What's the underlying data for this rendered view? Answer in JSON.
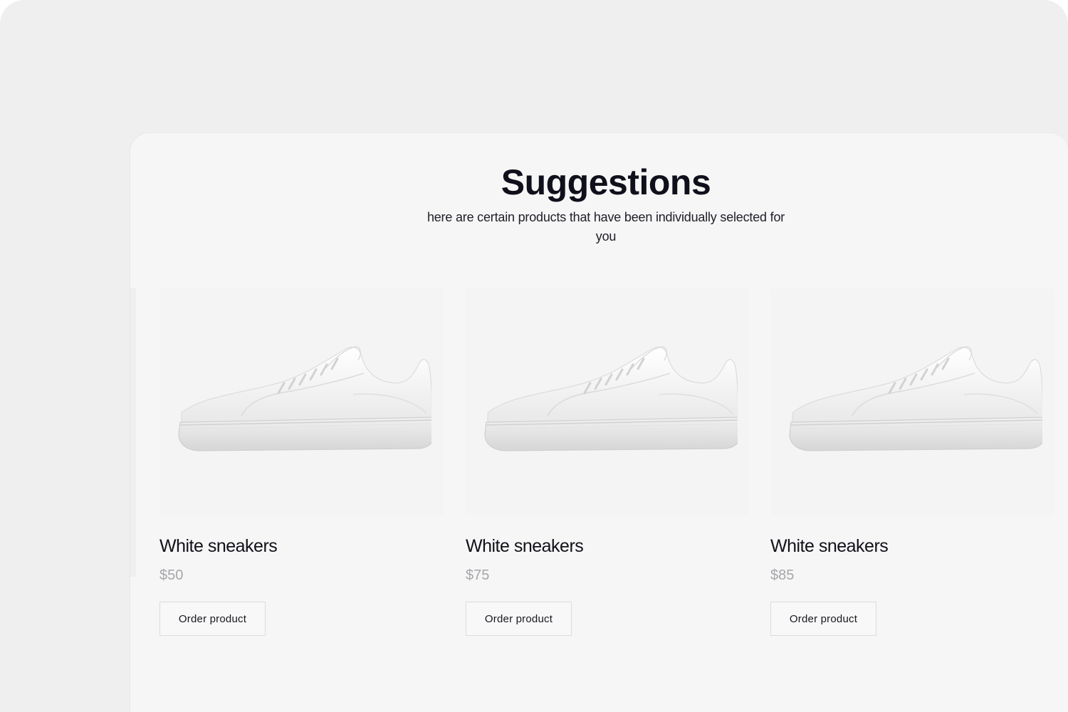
{
  "header": {
    "title": "Suggestions",
    "subtitle": "here are certain products that have been individually selected for you"
  },
  "products": [
    {
      "name": "White sneakers",
      "price": "$50",
      "button_label": "Order product",
      "image_icon": "white-sneaker-image"
    },
    {
      "name": "White sneakers",
      "price": "$75",
      "button_label": "Order product",
      "image_icon": "white-sneaker-image"
    },
    {
      "name": "White sneakers",
      "price": "$85",
      "button_label": "Order product",
      "image_icon": "white-sneaker-image"
    }
  ],
  "colors": {
    "background": "#efefef",
    "panel": "#f6f6f6",
    "text_primary": "#10101c",
    "text_muted": "#a6a6ab",
    "button_border": "#dcdcdf"
  }
}
